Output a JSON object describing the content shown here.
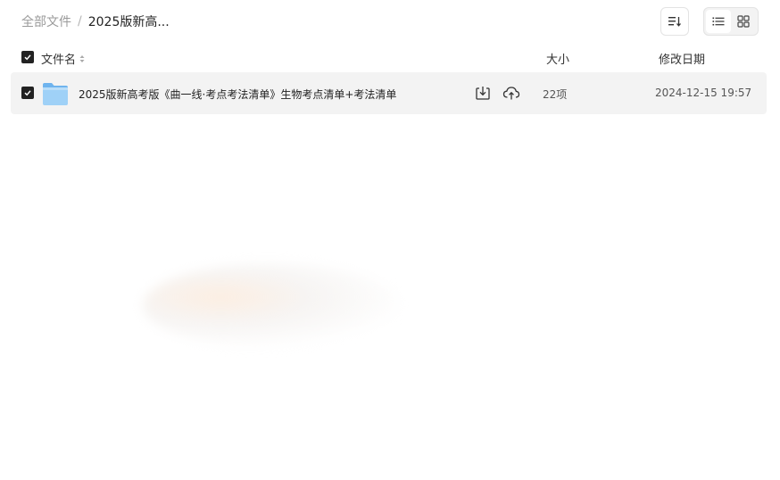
{
  "breadcrumb": {
    "root": "全部文件",
    "separator": "/",
    "current": "2025版新高..."
  },
  "toolbar": {
    "sort_icon": "sort-lines-icon",
    "list_view_icon": "list-view-icon",
    "grid_view_icon": "grid-view-icon",
    "active_view": "list"
  },
  "table": {
    "headers": {
      "name": "文件名",
      "size": "大小",
      "date": "修改日期"
    },
    "rows": [
      {
        "name": "2025版新高考版《曲一线·考点考法清单》生物考点清单+考法清单",
        "size": "22项",
        "date": "2024-12-15 19:57",
        "type_icon": "folder-icon",
        "checked": true
      }
    ]
  },
  "colors": {
    "row_bg": "#f3f3f3",
    "checkbox": "#222222",
    "folder": "#8cc8f5",
    "muted_text": "#9a9a9a"
  }
}
